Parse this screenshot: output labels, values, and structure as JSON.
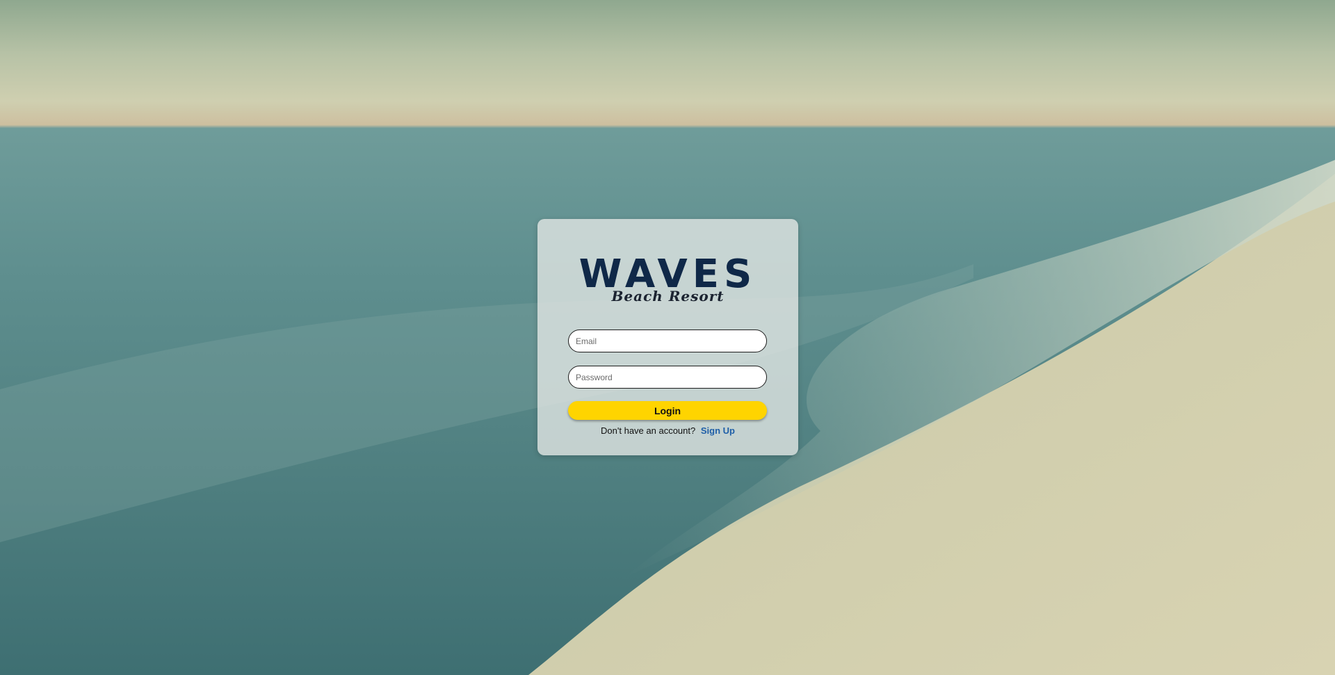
{
  "background": {
    "scene": "beach-waves-image"
  },
  "login_card": {
    "logo": {
      "title": "WAVES",
      "subtitle": "Beach Resort"
    },
    "email_field": {
      "value": "",
      "placeholder": "Email"
    },
    "password_field": {
      "value": "",
      "placeholder": "Password"
    },
    "login_button": {
      "label": "Login",
      "color": "#ffd400"
    },
    "signup": {
      "prompt": "Don't have an account?",
      "link_label": "Sign Up",
      "link_color": "#1f5fa8"
    }
  }
}
